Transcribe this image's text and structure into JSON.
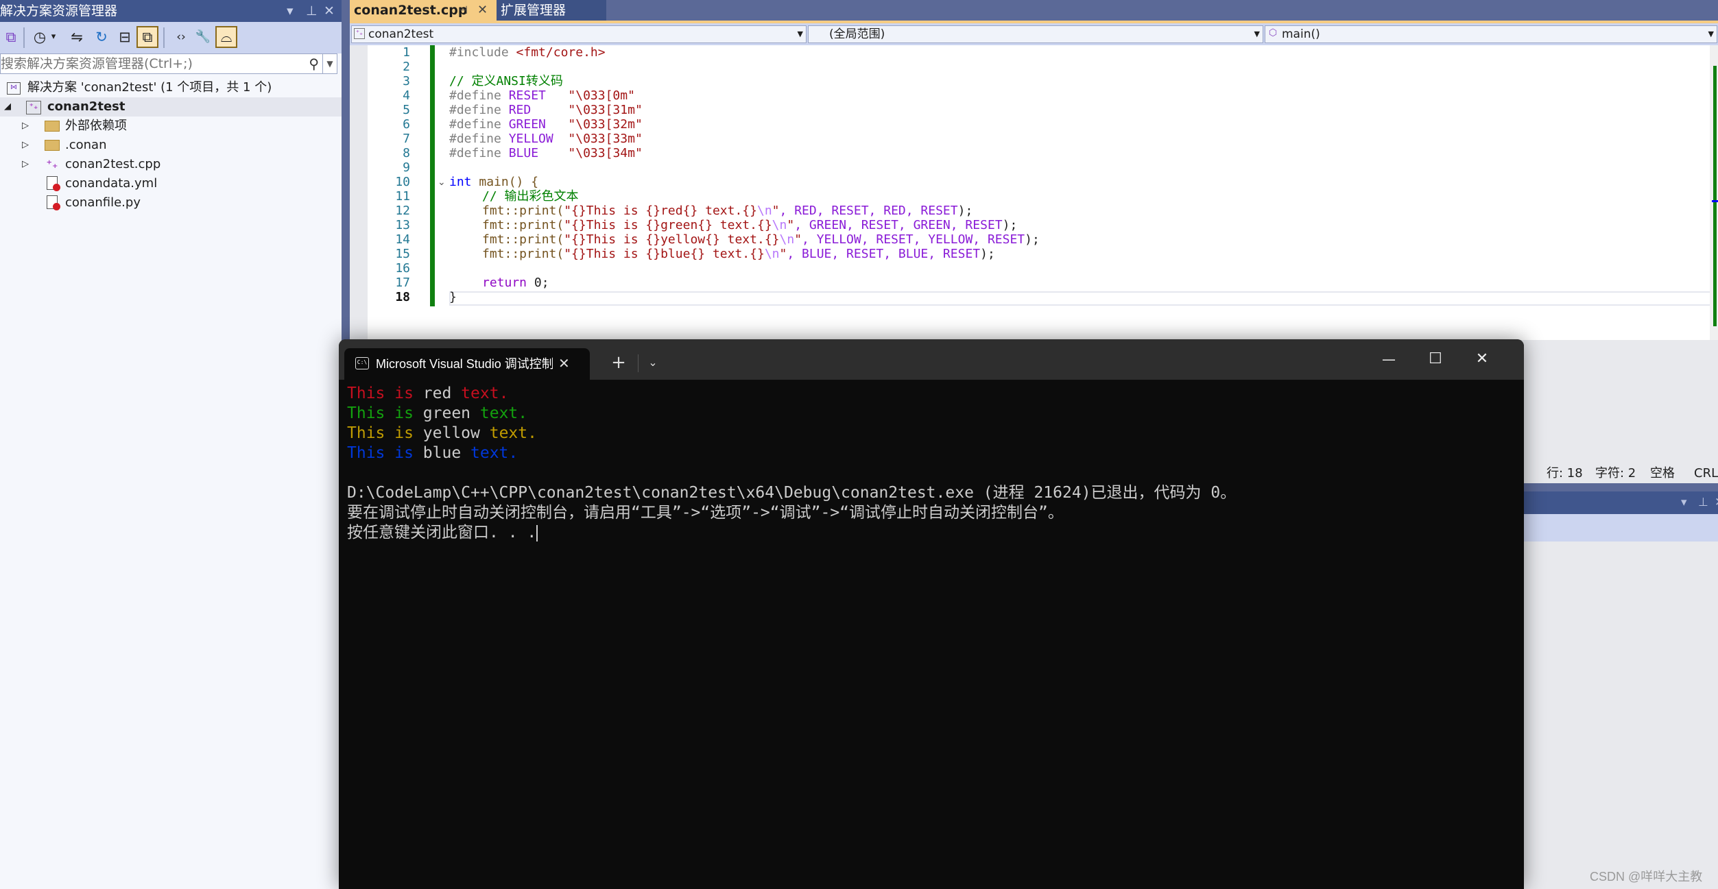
{
  "solution_explorer": {
    "title": "解决方案资源管理器",
    "title_controls": {
      "dropdown": "▾",
      "pin": "⊥",
      "close": "✕"
    },
    "toolbar": [
      {
        "name": "vs-solution-icon",
        "glyph": "⧉",
        "active": false
      },
      {
        "name": "history-icon",
        "glyph": "◷",
        "active": false
      },
      {
        "name": "dropdown-arrow-icon",
        "glyph": "▾",
        "active": false
      },
      {
        "name": "sync-icon",
        "glyph": "⇋",
        "active": false
      },
      {
        "name": "refresh-icon",
        "glyph": "↻",
        "active": false
      },
      {
        "name": "collapse-all-icon",
        "glyph": "⊟",
        "active": false
      },
      {
        "name": "show-all-files-icon",
        "glyph": "⧉",
        "active": true
      },
      {
        "name": "view-code-icon",
        "glyph": "‹›",
        "active": false
      },
      {
        "name": "properties-wrench-icon",
        "glyph": "🔧",
        "active": false
      },
      {
        "name": "preview-selected-icon",
        "glyph": "⌓",
        "active": true
      }
    ],
    "search_placeholder": "搜索解决方案资源管理器(Ctrl+;)",
    "tree": {
      "solution": "解决方案 'conan2test' (1 个项目，共 1 个)",
      "project": "conan2test",
      "items": [
        {
          "label": "外部依赖项",
          "type": "external-deps",
          "expandable": true
        },
        {
          "label": ".conan",
          "type": "folder",
          "expandable": true
        },
        {
          "label": "conan2test.cpp",
          "type": "cpp",
          "expandable": true
        },
        {
          "label": "conandata.yml",
          "type": "excluded-file",
          "expandable": false
        },
        {
          "label": "conanfile.py",
          "type": "excluded-file",
          "expandable": false
        }
      ]
    }
  },
  "editor": {
    "tabs": [
      {
        "label": "conan2test.cpp",
        "active": true,
        "pin": "⊣",
        "close": "✕"
      },
      {
        "label": "扩展管理器",
        "active": false
      }
    ],
    "nav": {
      "project": "conan2test",
      "scope": "(全局范围)",
      "member": "main()"
    },
    "current_line": 18,
    "lines": [
      {
        "n": "1"
      },
      {
        "n": "2"
      },
      {
        "n": "3"
      },
      {
        "n": "4"
      },
      {
        "n": "5"
      },
      {
        "n": "6"
      },
      {
        "n": "7"
      },
      {
        "n": "8"
      },
      {
        "n": "9"
      },
      {
        "n": "10"
      },
      {
        "n": "11"
      },
      {
        "n": "12"
      },
      {
        "n": "13"
      },
      {
        "n": "14"
      },
      {
        "n": "15"
      },
      {
        "n": "16"
      },
      {
        "n": "17"
      },
      {
        "n": "18"
      }
    ],
    "code": {
      "l1": [
        "#include ",
        "<fmt/core.h>"
      ],
      "l3": "// 定义ANSI转义码",
      "defines": [
        {
          "kw": "#define ",
          "name": "RESET",
          "pad": "   ",
          "val": "\"\\033[0m\""
        },
        {
          "kw": "#define ",
          "name": "RED",
          "pad": "     ",
          "val": "\"\\033[31m\""
        },
        {
          "kw": "#define ",
          "name": "GREEN",
          "pad": "   ",
          "val": "\"\\033[32m\""
        },
        {
          "kw": "#define ",
          "name": "YELLOW",
          "pad": "  ",
          "val": "\"\\033[33m\""
        },
        {
          "kw": "#define ",
          "name": "BLUE",
          "pad": "    ",
          "val": "\"\\033[34m\""
        }
      ],
      "l10": [
        "int",
        " main() {"
      ],
      "l11": "// 输出彩色文本",
      "prints": [
        {
          "fn": "fmt::print(",
          "str": "\"{}This is {}red{} text.{}",
          "esc": "\\n",
          "q": "\"",
          "args": ", RED, RESET, RED, RESET",
          "end": ");"
        },
        {
          "fn": "fmt::print(",
          "str": "\"{}This is {}green{} text.{}",
          "esc": "\\n",
          "q": "\"",
          "args": ", GREEN, RESET, GREEN, RESET",
          "end": ");"
        },
        {
          "fn": "fmt::print(",
          "str": "\"{}This is {}yellow{} text.{}",
          "esc": "\\n",
          "q": "\"",
          "args": ", YELLOW, RESET, YELLOW, RESET",
          "end": ");"
        },
        {
          "fn": "fmt::print(",
          "str": "\"{}This is {}blue{} text.{}",
          "esc": "\\n",
          "q": "\"",
          "args": ", BLUE, RESET, BLUE, RESET",
          "end": ");"
        }
      ],
      "l17": [
        "return",
        " 0;"
      ],
      "l18": "}"
    }
  },
  "status_bar": {
    "line": "行: 18",
    "char": "字符: 2",
    "spacing": "空格",
    "eol": "CRLF"
  },
  "output_pane": {
    "controls": {
      "dropdown": "▾",
      "pin": "⊥",
      "close": "✕"
    }
  },
  "terminal": {
    "tab_title": "Microsoft Visual Studio 调试控制台",
    "tab_icon": "C:\\",
    "close": "✕",
    "new_tab": "+",
    "dropdown": "⌄",
    "window_controls": {
      "minimize": "—",
      "maximize": "☐",
      "close": "✕"
    },
    "colors": {
      "red": "#c50f1f",
      "green": "#13a10e",
      "yellow": "#c19c00",
      "blue": "#0037da",
      "default": "#cccccc"
    },
    "output": [
      {
        "a": "This is ",
        "w": "red",
        "b": " text.",
        "color": "red"
      },
      {
        "a": "This is ",
        "w": "green",
        "b": " text.",
        "color": "green"
      },
      {
        "a": "This is ",
        "w": "yellow",
        "b": " text.",
        "color": "yellow"
      },
      {
        "a": "This is ",
        "w": "blue",
        "b": " text.",
        "color": "blue"
      }
    ],
    "exit_line": "D:\\CodeLamp\\C++\\CPP\\conan2test\\conan2test\\x64\\Debug\\conan2test.exe (进程 21624)已退出，代码为 0。",
    "hint_line": "要在调试停止时自动关闭控制台，请启用“工具”->“选项”->“调试”->“调试停止时自动关闭控制台”。",
    "press_key_line": "按任意键关闭此窗口. . ."
  },
  "watermark": "CSDN @咩咩大主教"
}
